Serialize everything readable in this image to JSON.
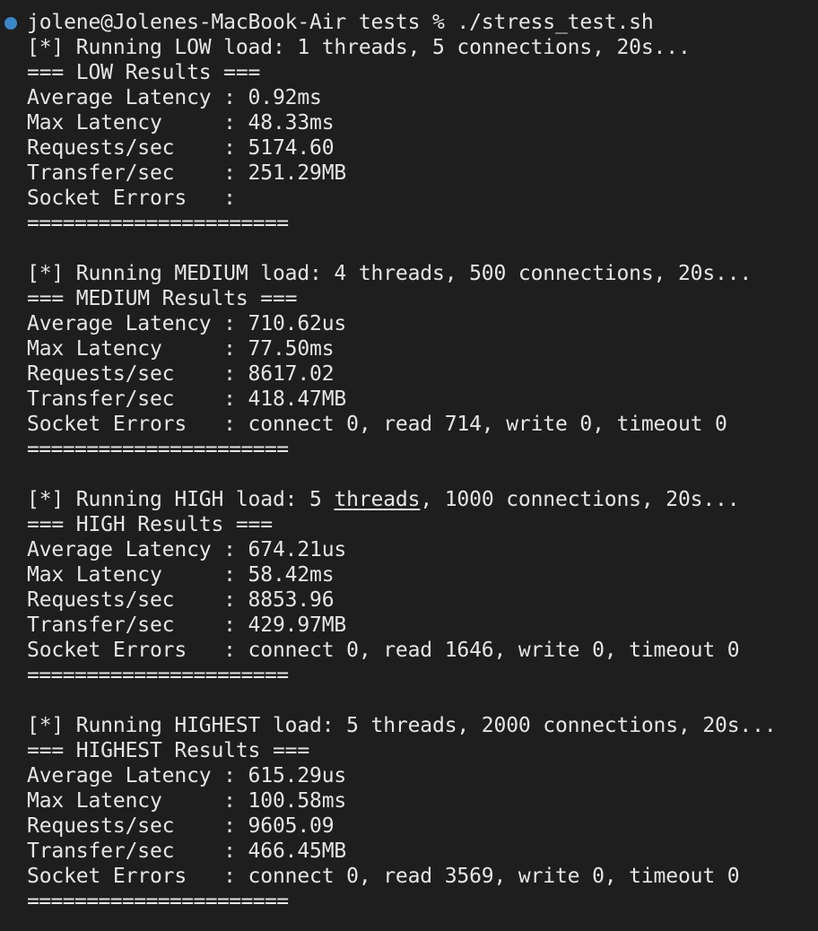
{
  "prompt": {
    "text": "jolene@Jolenes-MacBook-Air tests % ./stress_test.sh",
    "status_color": "#3a86c8"
  },
  "runs": [
    {
      "running": "[*] Running LOW load: 1 threads, 5 connections, 20s...",
      "header": "=== LOW Results ===",
      "avg_latency": "Average Latency : 0.92ms",
      "max_latency": "Max Latency     : 48.33ms",
      "requests": "Requests/sec    : 5174.60",
      "transfer": "Transfer/sec    : 251.29MB",
      "socket_errors": "Socket Errors   :",
      "separator": "======================"
    },
    {
      "running": "[*] Running MEDIUM load: 4 threads, 500 connections, 20s...",
      "header": "=== MEDIUM Results ===",
      "avg_latency": "Average Latency : 710.62us",
      "max_latency": "Max Latency     : 77.50ms",
      "requests": "Requests/sec    : 8617.02",
      "transfer": "Transfer/sec    : 418.47MB",
      "socket_errors": "Socket Errors   : connect 0, read 714, write 0, timeout 0",
      "separator": "======================"
    },
    {
      "running_before": "[*] Running HIGH load: 5 ",
      "running_link": "threads",
      "running_after": ", 1000 connections, 20s...",
      "header": "=== HIGH Results ===",
      "avg_latency": "Average Latency : 674.21us",
      "max_latency": "Max Latency     : 58.42ms",
      "requests": "Requests/sec    : 8853.96",
      "transfer": "Transfer/sec    : 429.97MB",
      "socket_errors": "Socket Errors   : connect 0, read 1646, write 0, timeout 0",
      "separator": "======================"
    },
    {
      "running": "[*] Running HIGHEST load: 5 threads, 2000 connections, 20s...",
      "header": "=== HIGHEST Results ===",
      "avg_latency": "Average Latency : 615.29us",
      "max_latency": "Max Latency     : 100.58ms",
      "requests": "Requests/sec    : 9605.09",
      "transfer": "Transfer/sec    : 466.45MB",
      "socket_errors": "Socket Errors   : connect 0, read 3569, write 0, timeout 0",
      "separator": "======================"
    }
  ]
}
